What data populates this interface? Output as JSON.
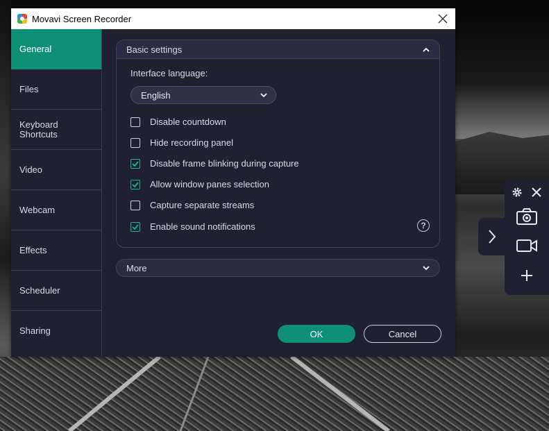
{
  "window": {
    "title": "Movavi Screen Recorder"
  },
  "sidebar": {
    "items": [
      {
        "label": "General",
        "active": true
      },
      {
        "label": "Files",
        "active": false
      },
      {
        "label": "Keyboard Shortcuts",
        "active": false
      },
      {
        "label": "Video",
        "active": false
      },
      {
        "label": "Webcam",
        "active": false
      },
      {
        "label": "Effects",
        "active": false
      },
      {
        "label": "Scheduler",
        "active": false
      },
      {
        "label": "Sharing",
        "active": false
      }
    ]
  },
  "basic_settings": {
    "title": "Basic settings",
    "interface_language_label": "Interface language:",
    "language_value": "English",
    "options": [
      {
        "label": "Disable countdown",
        "checked": false
      },
      {
        "label": "Hide recording panel",
        "checked": false
      },
      {
        "label": "Disable frame blinking during capture",
        "checked": true
      },
      {
        "label": "Allow window panes selection",
        "checked": true
      },
      {
        "label": "Capture separate streams",
        "checked": false
      },
      {
        "label": "Enable sound notifications",
        "checked": true
      }
    ],
    "help_symbol": "?"
  },
  "more": {
    "title": "More"
  },
  "buttons": {
    "ok": "OK",
    "cancel": "Cancel"
  },
  "colors": {
    "accent": "#0f8f76",
    "check": "#19b3a0",
    "panel_bg": "#1f2130"
  },
  "icons": {
    "close": "close-icon",
    "expand": "chevron-right-icon",
    "settings": "gear-icon",
    "screenshot": "camera-icon",
    "record": "video-camera-icon",
    "add": "plus-icon"
  }
}
